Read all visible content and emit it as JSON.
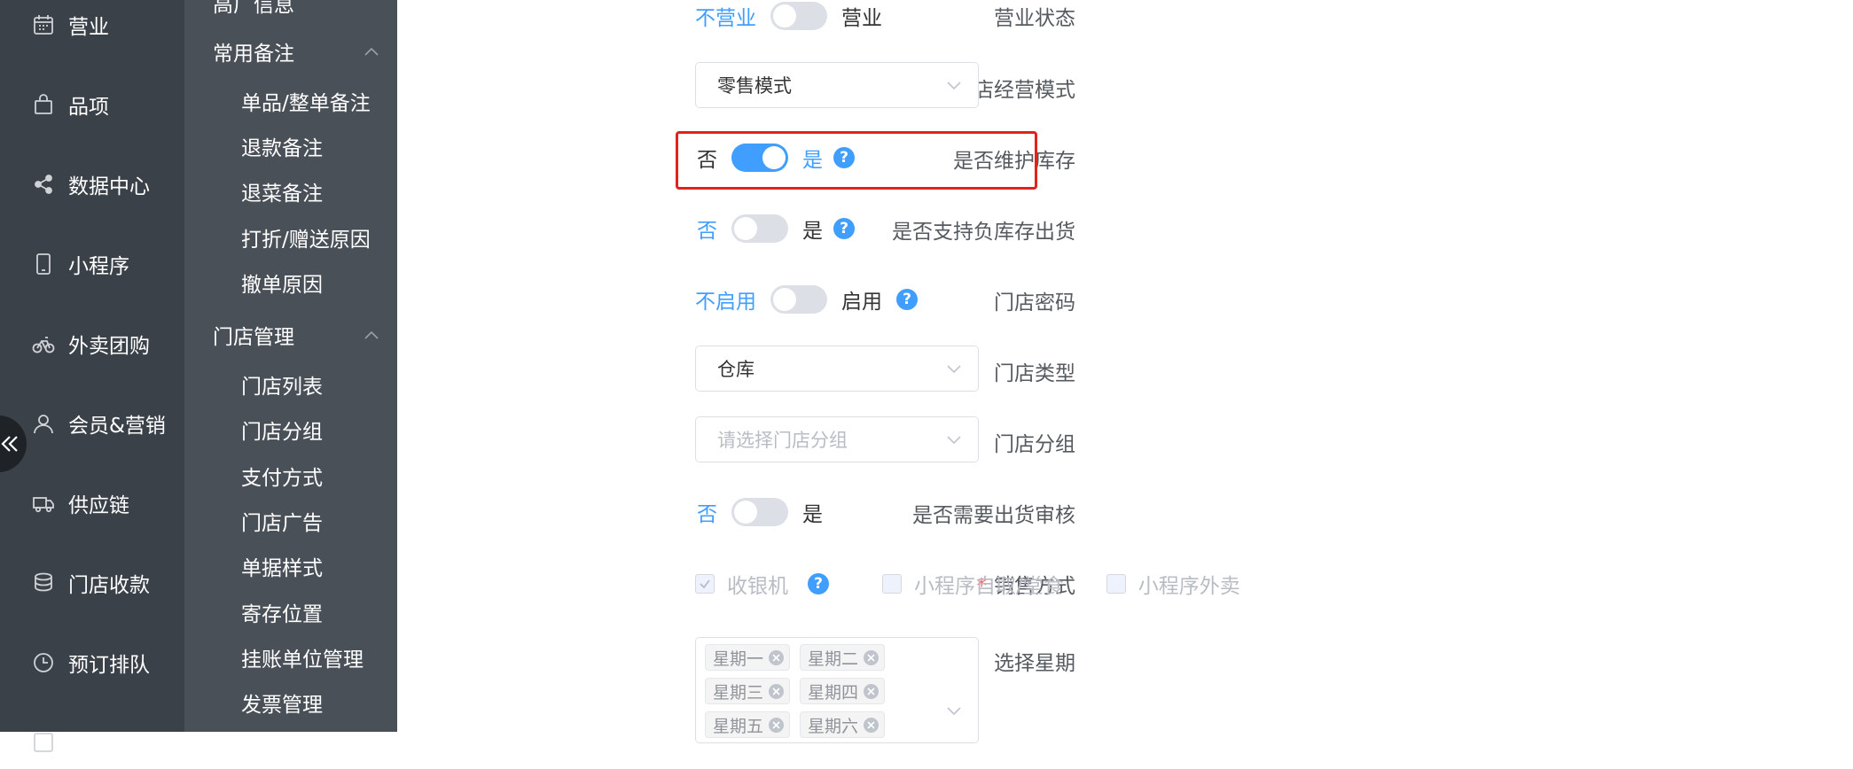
{
  "nav1": {
    "items": [
      {
        "label": "营业",
        "icon": "calendar-icon"
      },
      {
        "label": "品项",
        "icon": "bag-icon"
      },
      {
        "label": "数据中心",
        "icon": "share-icon"
      },
      {
        "label": "小程序",
        "icon": "phone-icon"
      },
      {
        "label": "外卖团购",
        "icon": "bike-icon"
      },
      {
        "label": "会员&营销",
        "icon": "user-icon"
      },
      {
        "label": "供应链",
        "icon": "truck-icon"
      },
      {
        "label": "门店收款",
        "icon": "coins-icon"
      },
      {
        "label": "预订排队",
        "icon": "clock-icon"
      },
      {
        "label": "",
        "icon": "more-icon"
      }
    ],
    "collapse_icon": "double-chevron-left-icon"
  },
  "nav2": {
    "top_partial": "高厂信息",
    "groups": [
      {
        "label": "常用备注",
        "items": [
          "单品/整单备注",
          "退款备注",
          "退菜备注",
          "打折/赠送原因",
          "撤单原因"
        ]
      },
      {
        "label": "门店管理",
        "items": [
          "门店列表",
          "门店分组",
          "支付方式",
          "门店广告",
          "单据样式",
          "寄存位置",
          "挂账单位管理",
          "发票管理"
        ]
      }
    ]
  },
  "form": {
    "business_status": {
      "label": "营业状态",
      "off": "不营业",
      "on": "营业",
      "value": false
    },
    "store_mode": {
      "label": "门店经营模式",
      "value": "零售模式"
    },
    "maintain_stock": {
      "label": "是否维护库存",
      "off": "否",
      "on": "是",
      "value": true
    },
    "negative_stock": {
      "label": "是否支持负库存出货",
      "off": "否",
      "on": "是",
      "value": false
    },
    "store_password": {
      "label": "门店密码",
      "off": "不启用",
      "on": "启用",
      "value": false
    },
    "store_type": {
      "label": "门店类型",
      "value": "仓库"
    },
    "store_group": {
      "label": "门店分组",
      "placeholder": "请选择门店分组"
    },
    "shipping_review": {
      "label": "是否需要出货审核",
      "off": "否",
      "on": "是",
      "value": false
    },
    "sales_method": {
      "required_mark": "*",
      "label": "销售方式",
      "options": [
        {
          "label": "收银机",
          "checked": true
        },
        {
          "label": "小程序自取/堂食",
          "checked": false
        },
        {
          "label": "小程序外卖",
          "checked": false
        }
      ]
    },
    "weekdays": {
      "label": "选择星期",
      "tags": [
        "星期一",
        "星期二",
        "星期三",
        "星期四",
        "星期五",
        "星期六"
      ]
    }
  },
  "help_glyph": "?",
  "colors": {
    "accent": "#409eff",
    "highlight": "#e2231a",
    "sidebar": "#3b4148",
    "submenu": "#4a5058"
  }
}
